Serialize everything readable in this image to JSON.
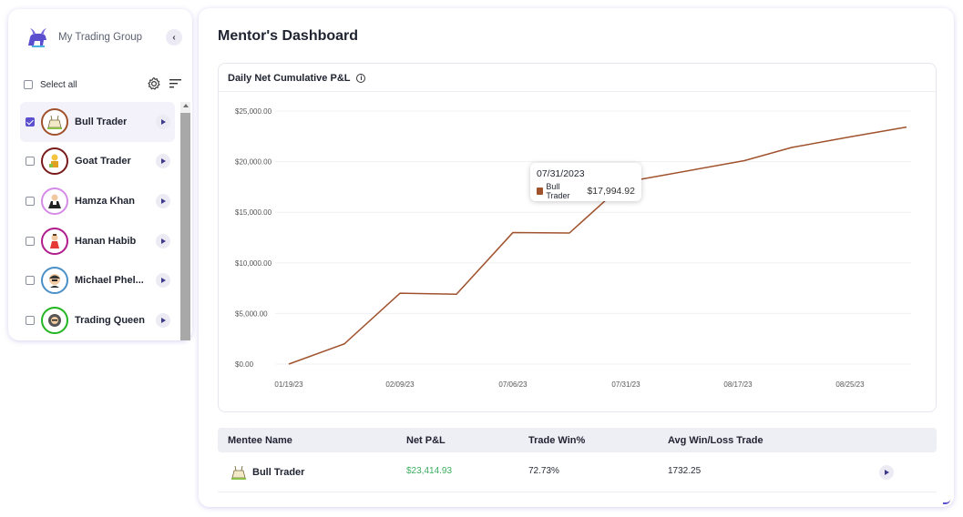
{
  "sidebar": {
    "group_name": "My Trading Group",
    "select_all_label": "Select all",
    "members": [
      {
        "name": "Bull Trader",
        "checked": true,
        "ring_color": "#a0522d"
      },
      {
        "name": "Goat Trader",
        "checked": false,
        "ring_color": "#7a1a1a"
      },
      {
        "name": "Hamza Khan",
        "checked": false,
        "ring_color": "#d58be8"
      },
      {
        "name": "Hanan Habib",
        "checked": false,
        "ring_color": "#b01c8c"
      },
      {
        "name": "Michael Phel...",
        "checked": false,
        "ring_color": "#4a90c8"
      },
      {
        "name": "Trading Queen",
        "checked": false,
        "ring_color": "#22b522"
      }
    ]
  },
  "main": {
    "title": "Mentor's Dashboard",
    "chart_card_title": "Daily Net Cumulative P&L"
  },
  "chart_data": {
    "type": "line",
    "title": "Daily Net Cumulative P&L",
    "x_ticks": [
      "01/19/23",
      "02/09/23",
      "07/06/23",
      "07/31/23",
      "08/17/23",
      "08/25/23"
    ],
    "y_ticks": [
      "$0.00",
      "$5,000.00",
      "$10,000.00",
      "$15,000.00",
      "$20,000.00",
      "$25,000.00"
    ],
    "ylim": [
      0,
      25000
    ],
    "series": [
      {
        "name": "Bull Trader",
        "color": "#a0522d",
        "points": [
          {
            "x": "01/19/23",
            "y": 0
          },
          {
            "x": "01/30/23",
            "y": 2000
          },
          {
            "x": "02/09/23",
            "y": 7000
          },
          {
            "x": "02/20/23",
            "y": 6900
          },
          {
            "x": "07/06/23",
            "y": 13000
          },
          {
            "x": "07/18/23",
            "y": 12950
          },
          {
            "x": "07/31/23",
            "y": 17994.92
          },
          {
            "x": "08/17/23",
            "y": 20100
          },
          {
            "x": "08/21/23",
            "y": 21400
          },
          {
            "x": "08/25/23",
            "y": 22450
          },
          {
            "x": "08/30/23",
            "y": 23414.93
          }
        ]
      }
    ],
    "tooltip": {
      "date": "07/31/2023",
      "series": "Bull Trader",
      "value": "$17,994.92"
    },
    "grid": true
  },
  "table": {
    "headers": [
      "Mentee Name",
      "Net P&L",
      "Trade Win%",
      "Avg Win/Loss Trade"
    ],
    "rows": [
      {
        "name": "Bull Trader",
        "net_pnl": "$23,414.93",
        "win_pct": "72.73%",
        "avg_win_loss": "1732.25"
      }
    ]
  }
}
